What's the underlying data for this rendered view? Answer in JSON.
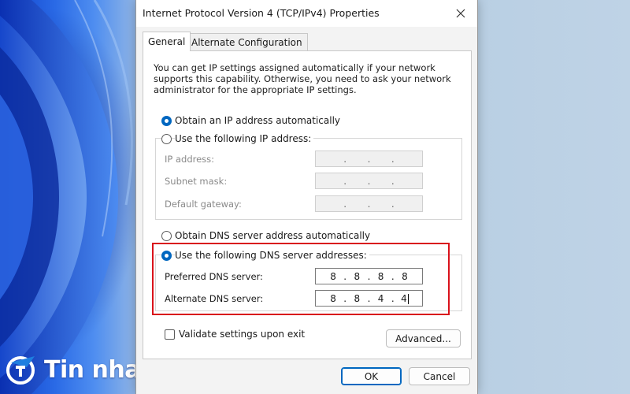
{
  "brand": {
    "name": "Tin nhanh plus"
  },
  "dialog": {
    "title": "Internet Protocol Version 4 (TCP/IPv4) Properties",
    "tabs": [
      "General",
      "Alternate Configuration"
    ],
    "description": "You can get IP settings assigned automatically if your network supports this capability. Otherwise, you need to ask your network administrator for the appropriate IP settings.",
    "ip_section": {
      "auto_label": "Obtain an IP address automatically",
      "manual_label": "Use the following IP address:",
      "selected": "auto",
      "fields": [
        {
          "label": "IP address:",
          "octets": [
            "",
            "",
            "",
            ""
          ]
        },
        {
          "label": "Subnet mask:",
          "octets": [
            "",
            "",
            "",
            ""
          ]
        },
        {
          "label": "Default gateway:",
          "octets": [
            "",
            "",
            "",
            ""
          ]
        }
      ]
    },
    "dns_section": {
      "auto_label": "Obtain DNS server address automatically",
      "manual_label": "Use the following DNS server addresses:",
      "selected": "manual",
      "preferred": {
        "label": "Preferred DNS server:",
        "octets": [
          "8",
          "8",
          "8",
          "8"
        ]
      },
      "alternate": {
        "label": "Alternate DNS server:",
        "octets": [
          "8",
          "8",
          "4",
          "4"
        ]
      }
    },
    "validate_label": "Validate settings upon exit",
    "validate_checked": false,
    "advanced_label": "Advanced...",
    "ok_label": "OK",
    "cancel_label": "Cancel"
  },
  "colors": {
    "accent": "#0067c0",
    "highlight": "#d9121b"
  },
  "icons": {
    "close": "close-icon",
    "brand": "brand-logo-icon"
  }
}
